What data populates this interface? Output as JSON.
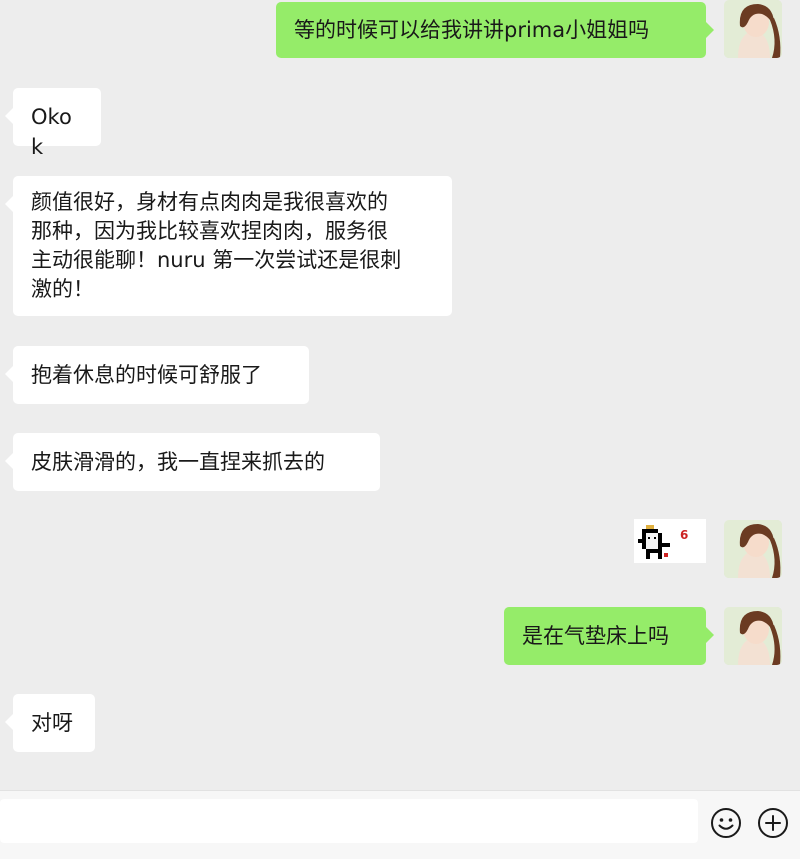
{
  "conversation": {
    "messages": [
      {
        "side": "out",
        "text": "等的时候可以给我讲讲prima小姐姐吗"
      },
      {
        "side": "in",
        "text": "Okok"
      },
      {
        "side": "in",
        "lines": [
          "颜值很好，身材有点肉肉是我很喜欢的",
          "那种，因为我比较喜欢捏肉肉，服务很",
          "主动很能聊！nuru 第一次尝试还是很刺",
          "激的！"
        ]
      },
      {
        "side": "in",
        "text": "抱着休息的时候可舒服了"
      },
      {
        "side": "in",
        "text": "皮肤滑滑的，我一直捏来抓去的"
      },
      {
        "side": "out",
        "type": "sticker",
        "sticker_number": "6",
        "sticker_icon": "pixel-cat-sticker"
      },
      {
        "side": "out",
        "text": "是在气垫床上吗"
      },
      {
        "side": "in",
        "text": "对呀"
      }
    ]
  },
  "input_bar": {
    "placeholder": "",
    "emoji_icon": "smiley-icon",
    "more_icon": "plus-circle-icon"
  },
  "colors": {
    "background": "#ededed",
    "incoming_bubble": "#ffffff",
    "outgoing_bubble": "#95ec69",
    "text": "#191919"
  }
}
